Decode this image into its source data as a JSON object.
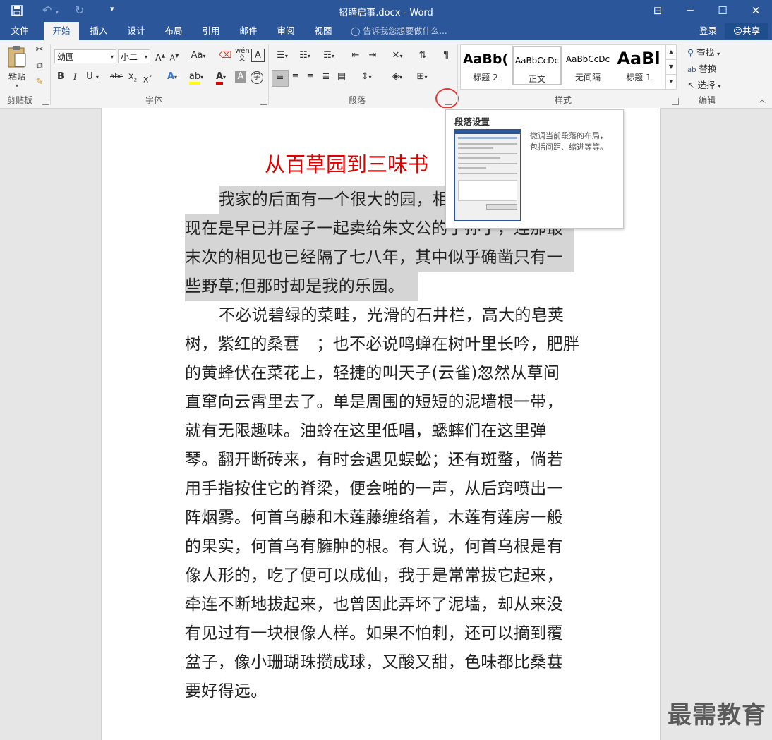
{
  "window": {
    "title": "招聘启事.docx - Word",
    "minimize_icon": "─",
    "maximize_icon": "☐",
    "close_icon": "✕",
    "ribbon_opts_icon": "⊟"
  },
  "quick_access": {
    "save": "save-icon",
    "undo": "undo-icon",
    "redo": "redo-icon",
    "customize": "▾"
  },
  "tabs": [
    {
      "label": "文件"
    },
    {
      "label": "开始"
    },
    {
      "label": "插入"
    },
    {
      "label": "设计"
    },
    {
      "label": "布局"
    },
    {
      "label": "引用"
    },
    {
      "label": "邮件"
    },
    {
      "label": "审阅"
    },
    {
      "label": "视图"
    }
  ],
  "tell_me": "告诉我您想要做什么...",
  "login": "登录",
  "share": "共享",
  "ribbon": {
    "clipboard": {
      "paste": "粘贴",
      "group": "剪贴板"
    },
    "font": {
      "name": "幼圆",
      "size": "小二",
      "group": "字体",
      "wen": "wén",
      "a_char": "A"
    },
    "paragraph": {
      "group": "段落"
    },
    "styles": {
      "group": "样式",
      "items": [
        {
          "sample": "AaBb(",
          "name": "标题 2"
        },
        {
          "sample": "AaBbCcDc",
          "name": "正文"
        },
        {
          "sample": "AaBbCcDc",
          "name": "无间隔"
        },
        {
          "sample": "AaBl",
          "name": "标题 1"
        }
      ]
    },
    "editing": {
      "find": "查找",
      "replace": "替换",
      "select": "选择",
      "group": "编辑"
    }
  },
  "tooltip": {
    "title": "段落设置",
    "desc_line1": "微调当前段落的布局，",
    "desc_line2": "包括间距、缩进等等。"
  },
  "document": {
    "title": "从百草园到三味书",
    "lines": [
      "我家的后面有一个很大的园，相",
      "现在是早已并屋子一起卖给朱文公的子孙了，连那最",
      "末次的相见也已经隔了七八年，其中似乎确凿只有一",
      "些野草;但那时却是我的乐园。",
      "不必说碧绿的菜畦，光滑的石井栏，高大的皂荚",
      "树，紫红的桑葚　；也不必说鸣蝉在树叶里长吟，肥胖",
      "的黄蜂伏在菜花上，轻捷的叫天子(云雀)忽然从草间",
      "直窜向云霄里去了。单是周围的短短的泥墙根一带，",
      "就有无限趣味。油蛉在这里低唱，蟋蟀们在这里弹",
      "琴。翻开断砖来，有时会遇见蜈蚣；还有斑蝥，倘若",
      "用手指按住它的脊梁，便会啪的一声，从后窍喷出一",
      "阵烟雾。何首乌藤和木莲藤缠络着，木莲有莲房一般",
      "的果实，何首乌有臃肿的根。有人说，何首乌根是有",
      "像人形的，吃了便可以成仙，我于是常常拔它起来，",
      "牵连不断地拔起来，也曾因此弄坏了泥墙，却从来没",
      "有见过有一块根像人样。如果不怕刺，还可以摘到覆",
      "盆子，像小珊瑚珠攒成球，又酸又甜，色味都比桑葚",
      "要好得远。"
    ]
  },
  "watermark": "最需教育"
}
